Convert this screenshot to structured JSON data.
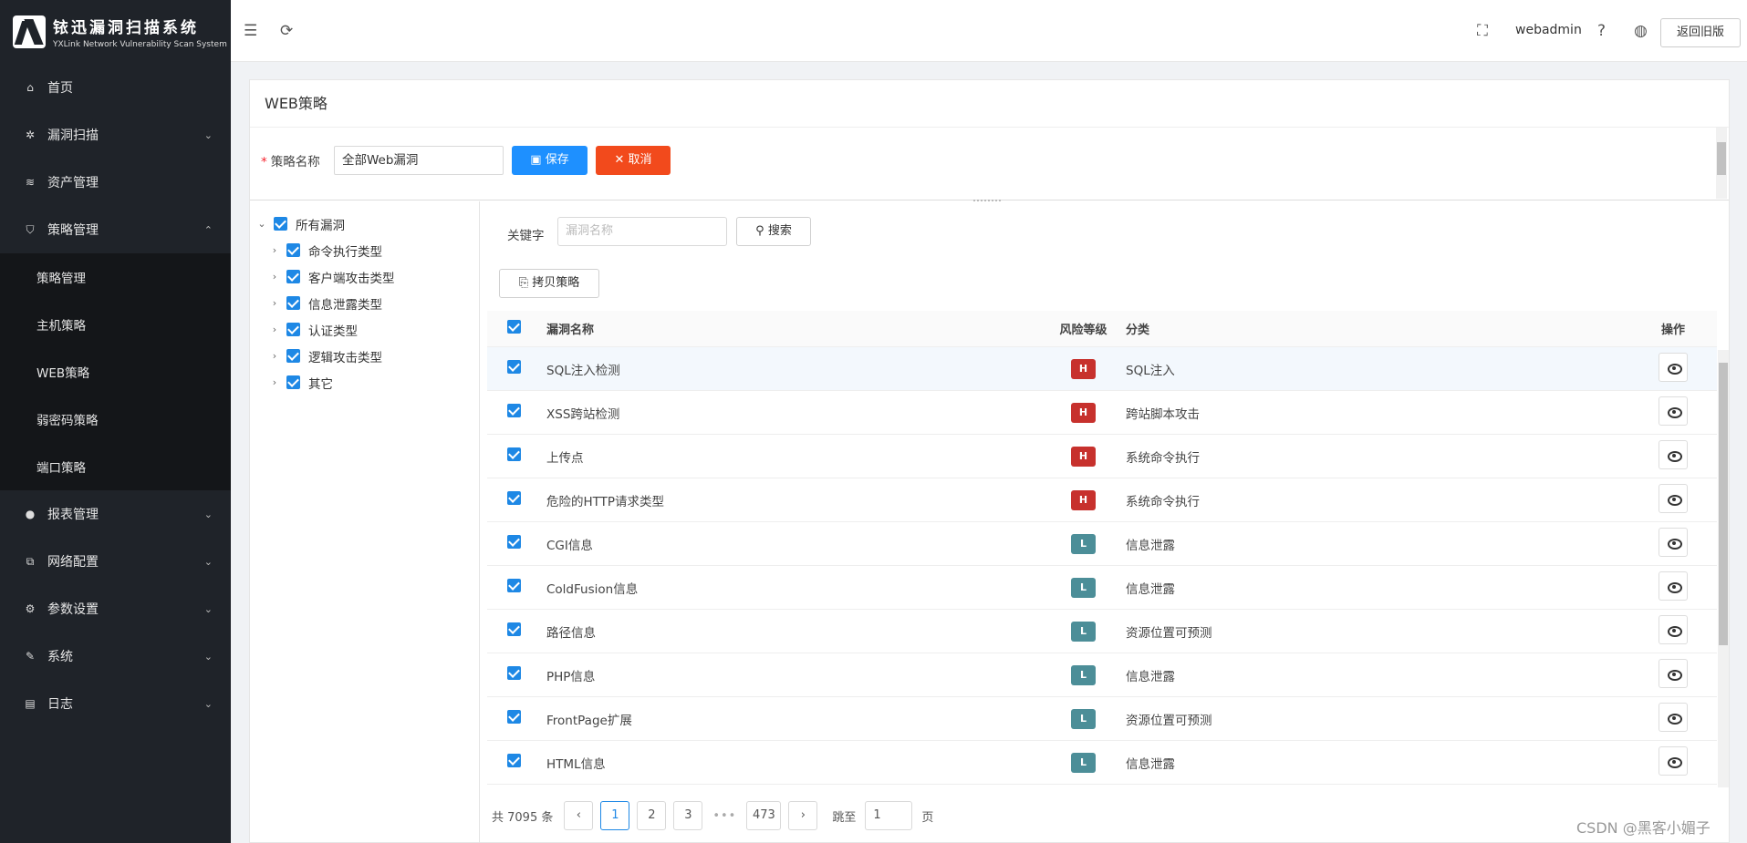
{
  "app": {
    "title": "铱迅漏洞扫描系统",
    "subtitle": "YXLink Network Vulnerability Scan System"
  },
  "sidebar": {
    "items": [
      {
        "label": "首页",
        "icon": "home-icon",
        "glyph": "⌂",
        "chev": ""
      },
      {
        "label": "漏洞扫描",
        "icon": "bug-icon",
        "glyph": "✲",
        "chev": "⌄"
      },
      {
        "label": "资产管理",
        "icon": "layers-icon",
        "glyph": "≋",
        "chev": ""
      },
      {
        "label": "策略管理",
        "icon": "shield-icon",
        "glyph": "⛉",
        "chev": "⌃"
      },
      {
        "label": "报表管理",
        "icon": "chart-icon",
        "glyph": "●",
        "chev": "⌄"
      },
      {
        "label": "网络配置",
        "icon": "network-icon",
        "glyph": "⧉",
        "chev": "⌄"
      },
      {
        "label": "参数设置",
        "icon": "gear-icon",
        "glyph": "⚙",
        "chev": "⌄"
      },
      {
        "label": "系统",
        "icon": "wrench-icon",
        "glyph": "✎",
        "chev": "⌄"
      },
      {
        "label": "日志",
        "icon": "log-icon",
        "glyph": "▤",
        "chev": "⌄"
      }
    ],
    "submenu": [
      "策略管理",
      "主机策略",
      "WEB策略",
      "弱密码策略",
      "端口策略"
    ]
  },
  "topbar": {
    "user": "webadmin",
    "back_button": "返回旧版",
    "icons": [
      "menu-fold-icon",
      "refresh-icon",
      "fullscreen-icon",
      "help-icon",
      "globe-icon"
    ]
  },
  "panel": {
    "title": "WEB策略",
    "form": {
      "label": "策略名称",
      "value": "全部Web漏洞",
      "save": "保存",
      "cancel": "取消"
    }
  },
  "tree": {
    "root": "所有漏洞",
    "children": [
      "命令执行类型",
      "客户端攻击类型",
      "信息泄露类型",
      "认证类型",
      "逻辑攻击类型",
      "其它"
    ]
  },
  "search": {
    "label": "关键字",
    "placeholder": "漏洞名称",
    "button": "搜索",
    "copy_button": "拷贝策略"
  },
  "table": {
    "headers": {
      "name": "漏洞名称",
      "risk": "风险等级",
      "category": "分类",
      "action": "操作"
    },
    "rows": [
      {
        "name": "SQL注入检测",
        "risk": "H",
        "category": "SQL注入"
      },
      {
        "name": "XSS跨站检测",
        "risk": "H",
        "category": "跨站脚本攻击"
      },
      {
        "name": "上传点",
        "risk": "H",
        "category": "系统命令执行"
      },
      {
        "name": "危险的HTTP请求类型",
        "risk": "H",
        "category": "系统命令执行"
      },
      {
        "name": "CGI信息",
        "risk": "L",
        "category": "信息泄露"
      },
      {
        "name": "ColdFusion信息",
        "risk": "L",
        "category": "信息泄露"
      },
      {
        "name": "路径信息",
        "risk": "L",
        "category": "资源位置可预测"
      },
      {
        "name": "PHP信息",
        "risk": "L",
        "category": "信息泄露"
      },
      {
        "name": "FrontPage扩展",
        "risk": "L",
        "category": "资源位置可预测"
      },
      {
        "name": "HTML信息",
        "risk": "L",
        "category": "信息泄露"
      }
    ]
  },
  "pagination": {
    "total": "共 7095 条",
    "pages": [
      "1",
      "2",
      "3"
    ],
    "dots": "•••",
    "last": "473",
    "jump_label": "跳至",
    "jump_value": "1",
    "page_suffix": "页",
    "prev": "‹",
    "next": "›"
  },
  "watermark": "CSDN @黑客小媚子",
  "colors": {
    "primary": "#1e88e5",
    "danger": "#f24a1c",
    "high": "#c7312d",
    "low": "#4c8e98",
    "sidebar": "#1f2329"
  }
}
